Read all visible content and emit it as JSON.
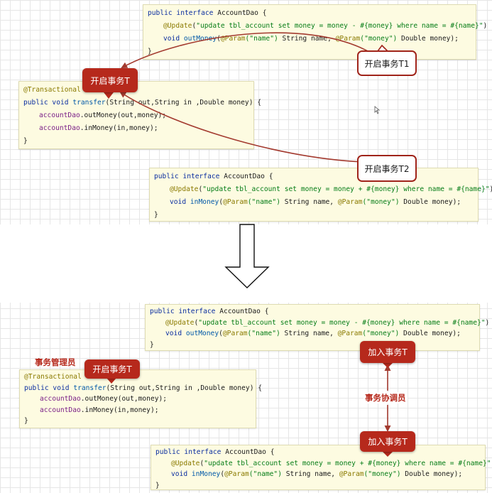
{
  "colors": {
    "tag_red": "#b6291c",
    "code_bg": "#fdfbe1",
    "keyword": "#0b2ea0",
    "annotation": "#8a7a00",
    "string": "#067d17"
  },
  "top": {
    "dao_out": {
      "l1": {
        "kw": "public interface",
        "name": " AccountDao {"
      },
      "l2": {
        "an": "@Update",
        "p1": "(",
        "str": "\"update tbl_account set money = money - #{money} where name = #{name}\"",
        "p2": ")"
      },
      "l3": {
        "kw": "void",
        "fn": "outMoney",
        "a1": "(",
        "an1": "@Param",
        "s1": "(\"name\")",
        "t1": " String name, ",
        "an2": "@Param",
        "s2": "(\"money\")",
        "t2": " Double money);"
      },
      "l4": "}"
    },
    "service": {
      "l1": "@Transactional",
      "l2": {
        "kw": "public void",
        "fn": "transfer",
        "rest": "(String out,String in ,Double money) {"
      },
      "l3": {
        "fld": "accountDao",
        "rest": ".outMoney(out,money);"
      },
      "l4": {
        "fld": "accountDao",
        "rest": ".inMoney(in,money);"
      },
      "l5": "}"
    },
    "dao_in": {
      "l1": {
        "kw": "public interface",
        "name": " AccountDao {"
      },
      "l2": {
        "an": "@Update",
        "p1": "(",
        "str": "\"update tbl_account set money = money + #{money} where name = #{name}\"",
        "p2": ")"
      },
      "l3": {
        "kw": "void",
        "fn": "inMoney",
        "a1": "(",
        "an1": "@Param",
        "s1": "(\"name\")",
        "t1": " String name, ",
        "an2": "@Param",
        "s2": "(\"money\")",
        "t2": " Double money);"
      },
      "l4": "}"
    },
    "tag_service": "开启事务T",
    "tag_t1": "开启事务T1",
    "tag_t2": "开启事务T2"
  },
  "bottom": {
    "manager_label": "事务管理员",
    "coordinator_label": "事务协调员",
    "tag_service": "开启事务T",
    "tag_join_top": "加入事务T",
    "tag_join_bottom": "加入事务T"
  }
}
